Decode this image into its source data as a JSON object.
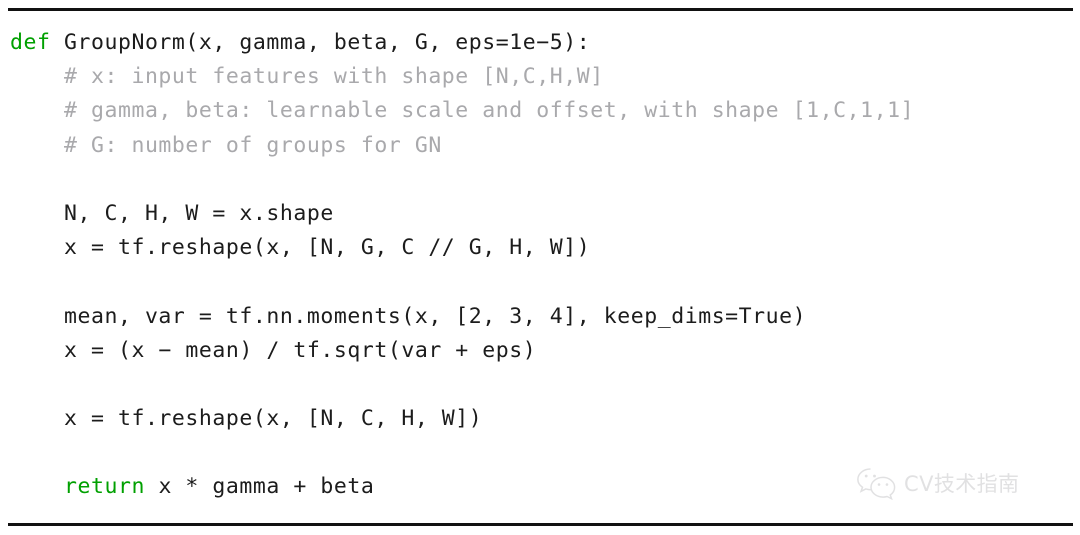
{
  "figure": {
    "kind": "code-listing",
    "language": "python",
    "background": "#ffffff",
    "rules": {
      "top_label": "top-horizontal-rule",
      "bottom_label": "bottom-horizontal-rule",
      "color": "#111111"
    }
  },
  "colors": {
    "keyword": "#00a000",
    "comment": "#a9a9ac",
    "code": "#1c1c1c",
    "rule": "#111111",
    "watermark": "#c9c9cc"
  },
  "code": {
    "lines": [
      {
        "segments": [
          {
            "type": "keyword",
            "text": "def"
          },
          {
            "type": "code",
            "text": " GroupNorm(x, gamma, beta, G, eps=1e−5):"
          }
        ]
      },
      {
        "segments": [
          {
            "type": "comment",
            "text": "    # x: input features with shape [N,C,H,W]"
          }
        ]
      },
      {
        "segments": [
          {
            "type": "comment",
            "text": "    # gamma, beta: learnable scale and offset, with shape [1,C,1,1]"
          }
        ]
      },
      {
        "segments": [
          {
            "type": "comment",
            "text": "    # G: number of groups for GN"
          }
        ]
      },
      {
        "segments": [
          {
            "type": "blank",
            "text": " "
          }
        ]
      },
      {
        "segments": [
          {
            "type": "code",
            "text": "    N, C, H, W = x.shape"
          }
        ]
      },
      {
        "segments": [
          {
            "type": "code",
            "text": "    x = tf.reshape(x, [N, G, C // G, H, W])"
          }
        ]
      },
      {
        "segments": [
          {
            "type": "blank",
            "text": " "
          }
        ]
      },
      {
        "segments": [
          {
            "type": "code",
            "text": "    mean, var = tf.nn.moments(x, [2, 3, 4], keep_dims=True)"
          }
        ]
      },
      {
        "segments": [
          {
            "type": "code",
            "text": "    x = (x − mean) / tf.sqrt(var + eps)"
          }
        ]
      },
      {
        "segments": [
          {
            "type": "blank",
            "text": " "
          }
        ]
      },
      {
        "segments": [
          {
            "type": "code",
            "text": "    x = tf.reshape(x, [N, C, H, W])"
          }
        ]
      },
      {
        "segments": [
          {
            "type": "blank",
            "text": " "
          }
        ]
      },
      {
        "segments": [
          {
            "type": "code",
            "text": "    "
          },
          {
            "type": "keyword",
            "text": "return"
          },
          {
            "type": "code",
            "text": " x * gamma + beta"
          }
        ]
      }
    ]
  },
  "watermark": {
    "icon": "wechat-icon",
    "text": "CV技术指南"
  }
}
